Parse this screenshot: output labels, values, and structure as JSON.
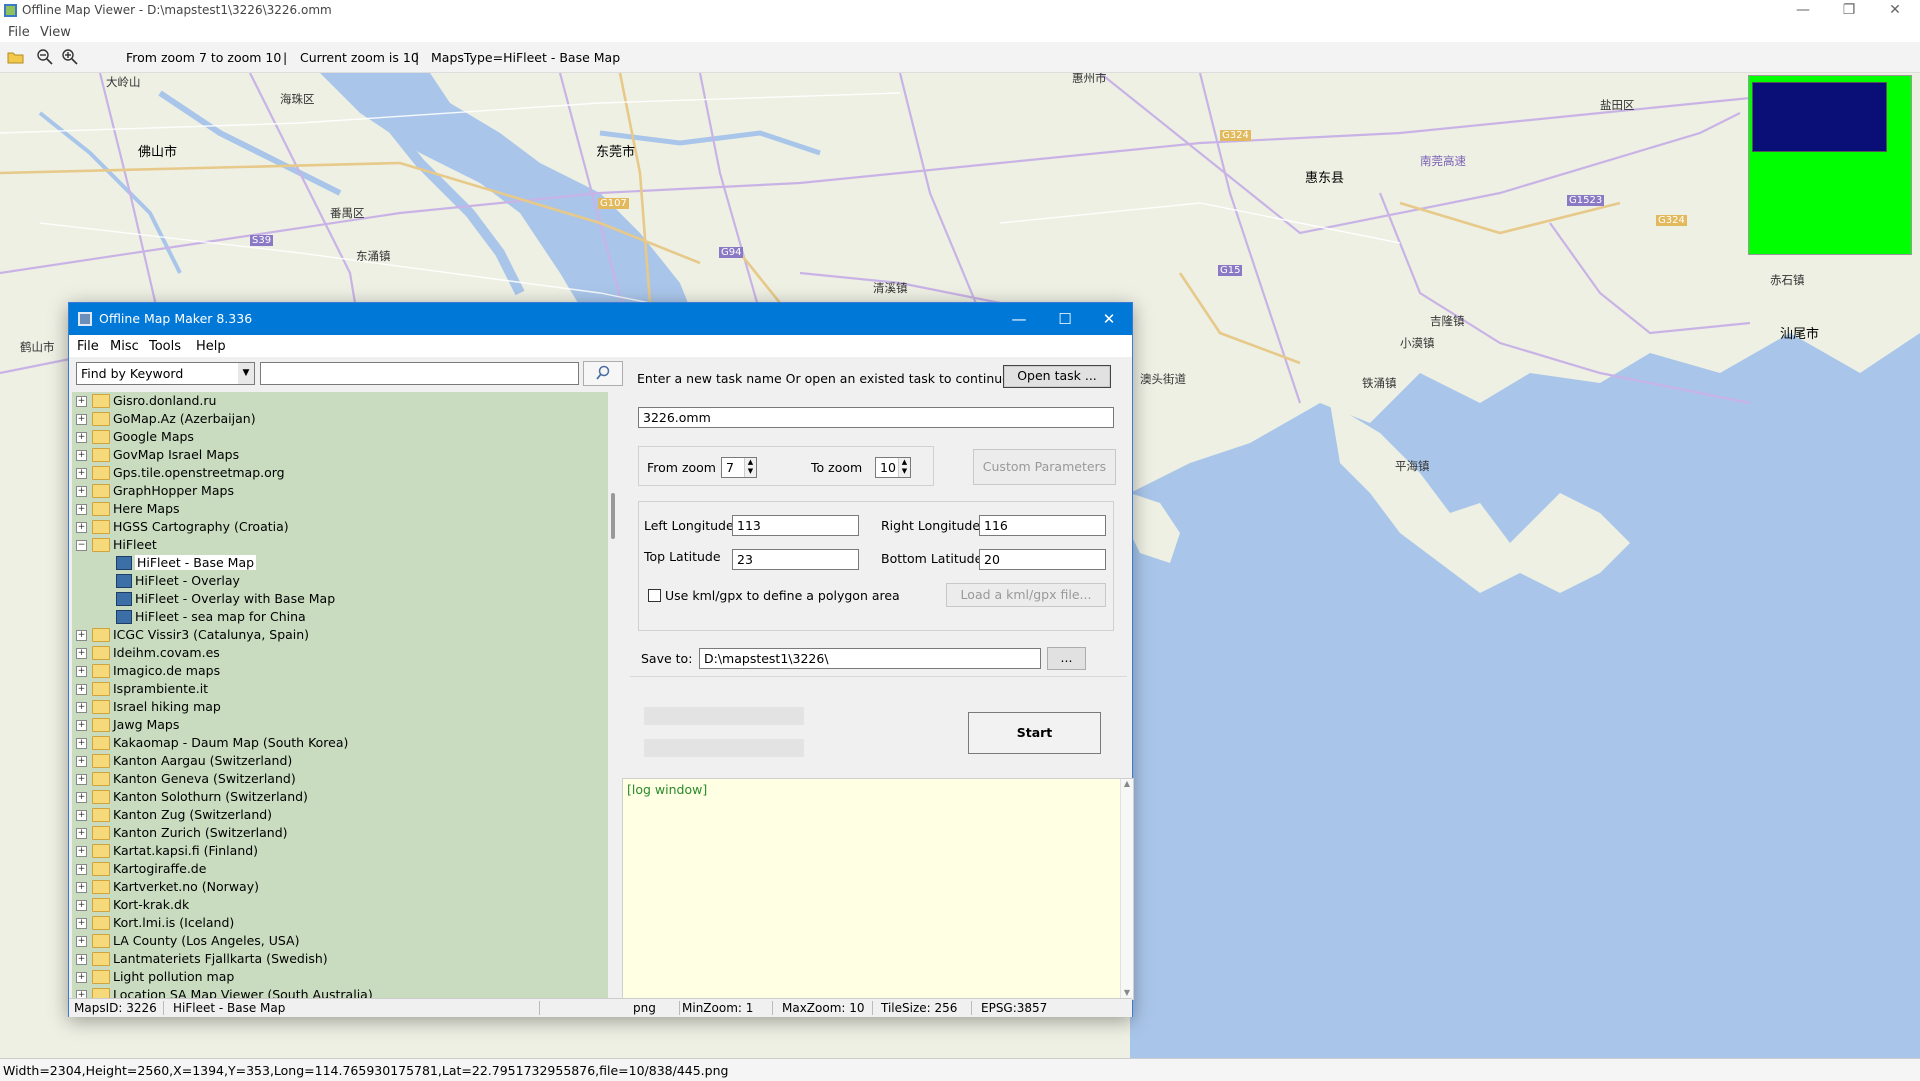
{
  "app": {
    "title": "Offline Map Viewer - D:\\mapstest1\\3226\\3226.omm",
    "menu": [
      "File",
      "View"
    ],
    "toolbar": {
      "zoom_range": "From zoom 7 to zoom 10",
      "current_zoom": "Current zoom is 10",
      "maps_type": "MapsType=HiFleet - Base Map",
      "sep1": "|",
      "sep2": "|"
    },
    "status": "Width=2304,Height=2560,X=1394,Y=353,Long=114.765930175781,Lat=22.7951732955876,file=10/838/445.png"
  },
  "map": {
    "labels": [
      {
        "name": "label-dalingshan",
        "text": "大岭山"
      },
      {
        "name": "label-foshan",
        "text": "佛山市"
      },
      {
        "name": "label-dongguan",
        "text": "东莞市"
      },
      {
        "name": "label-huizhou",
        "text": "惠州市"
      },
      {
        "name": "label-huidong",
        "text": "惠东县"
      },
      {
        "name": "label-shanwei",
        "text": "汕尾市"
      },
      {
        "name": "label-panyu",
        "text": "番禺区"
      },
      {
        "name": "label-haizhu",
        "text": "海珠区"
      },
      {
        "name": "label-heshan",
        "text": "鹤山市"
      },
      {
        "name": "label-dongchong",
        "text": "东涌镇"
      },
      {
        "name": "label-qingxi",
        "text": "清溪镇"
      },
      {
        "name": "label-pinghai",
        "text": "平海镇"
      },
      {
        "name": "label-aotou",
        "text": "澳头街道"
      },
      {
        "name": "label-xiaomo",
        "text": "小漠镇"
      },
      {
        "name": "label-jishi",
        "text": "吉隆镇"
      },
      {
        "name": "label-tiechong",
        "text": "铁涌镇"
      },
      {
        "name": "label-chishi",
        "text": "赤石镇"
      },
      {
        "name": "label-yanmao",
        "text": "盐田区"
      }
    ],
    "roads": [
      "G107",
      "G94",
      "S39",
      "G15",
      "G324",
      "G1523",
      "G324"
    ],
    "expressway": "南莞高速"
  },
  "dialog": {
    "title": "Offline Map Maker 8.336",
    "menu": [
      "File",
      "Misc",
      "Tools",
      "Help"
    ],
    "find_select": "Find by Keyword",
    "find_text": "",
    "search_icon": "search-icon",
    "tree": [
      {
        "label": "Gisro.donland.ru",
        "type": "folder"
      },
      {
        "label": "GoMap.Az (Azerbaijan)",
        "type": "folder"
      },
      {
        "label": "Google Maps",
        "type": "folder"
      },
      {
        "label": "GovMap Israel Maps",
        "type": "folder"
      },
      {
        "label": "Gps.tile.openstreetmap.org",
        "type": "folder"
      },
      {
        "label": "GraphHopper Maps",
        "type": "folder"
      },
      {
        "label": "Here Maps",
        "type": "folder"
      },
      {
        "label": "HGSS Cartography (Croatia)",
        "type": "folder"
      },
      {
        "label": "HiFleet",
        "type": "open-folder"
      },
      {
        "label": "HiFleet - Base Map",
        "type": "map",
        "selected": true
      },
      {
        "label": "HiFleet - Overlay",
        "type": "map"
      },
      {
        "label": "HiFleet - Overlay with Base Map",
        "type": "map"
      },
      {
        "label": "HiFleet - sea map for China",
        "type": "map"
      },
      {
        "label": "ICGC Vissir3 (Catalunya, Spain)",
        "type": "folder"
      },
      {
        "label": "Ideihm.covam.es",
        "type": "folder"
      },
      {
        "label": "Imagico.de maps",
        "type": "folder"
      },
      {
        "label": "Isprambiente.it",
        "type": "folder"
      },
      {
        "label": "Israel hiking map",
        "type": "folder"
      },
      {
        "label": "Jawg Maps",
        "type": "folder"
      },
      {
        "label": "Kakaomap - Daum Map (South Korea)",
        "type": "folder"
      },
      {
        "label": "Kanton Aargau (Switzerland)",
        "type": "folder"
      },
      {
        "label": "Kanton Geneva (Switzerland)",
        "type": "folder"
      },
      {
        "label": "Kanton Solothurn (Switzerland)",
        "type": "folder"
      },
      {
        "label": "Kanton Zug (Switzerland)",
        "type": "folder"
      },
      {
        "label": "Kanton Zurich (Switzerland)",
        "type": "folder"
      },
      {
        "label": "Kartat.kapsi.fi (Finland)",
        "type": "folder"
      },
      {
        "label": "Kartogiraffe.de",
        "type": "folder"
      },
      {
        "label": "Kartverket.no (Norway)",
        "type": "folder"
      },
      {
        "label": "Kort-krak.dk",
        "type": "folder"
      },
      {
        "label": "Kort.lmi.is (Iceland)",
        "type": "folder"
      },
      {
        "label": "LA County (Los Angeles, USA)",
        "type": "folder"
      },
      {
        "label": "Lantmateriets Fjallkarta (Swedish)",
        "type": "folder"
      },
      {
        "label": "Light pollution map",
        "type": "folder"
      },
      {
        "label": "Location SA Map Viewer (South Australia)",
        "type": "folder"
      }
    ],
    "task_prompt": "Enter a new task name Or open an existed task to continue:",
    "open_task": "Open task ...",
    "task_name": "3226.omm",
    "from_zoom_label": "From zoom",
    "from_zoom": "7",
    "to_zoom_label": "To zoom",
    "to_zoom": "10",
    "custom_params": "Custom Parameters",
    "left_lon_label": "Left Longitude",
    "left_lon": "113",
    "right_lon_label": "Right Longitude",
    "right_lon": "116",
    "top_lat_label": "Top Latitude",
    "top_lat": "23",
    "bottom_lat_label": "Bottom Latitude",
    "bottom_lat": "20",
    "kml_label": "Use kml/gpx to define a polygon area",
    "load_kml": "Load a kml/gpx file...",
    "save_label": "Save to:",
    "save_path": "D:\\mapstest1\\3226\\",
    "browse": "...",
    "start": "Start",
    "log": "[log window]",
    "status": {
      "maps_id": "MapsID: 3226",
      "map_name": "HiFleet - Base Map",
      "format": "png",
      "min_zoom": "MinZoom: 1",
      "max_zoom": "MaxZoom: 10",
      "tile_size": "TileSize: 256",
      "epsg": "EPSG:3857"
    }
  },
  "colors": {
    "land": "#eef0e4",
    "water": "#a9c6ea",
    "tree_bg": "#c9dcc0",
    "title_blue": "#0078d7",
    "minimap_green": "#00ff00",
    "minimap_view": "#0a0f78"
  }
}
